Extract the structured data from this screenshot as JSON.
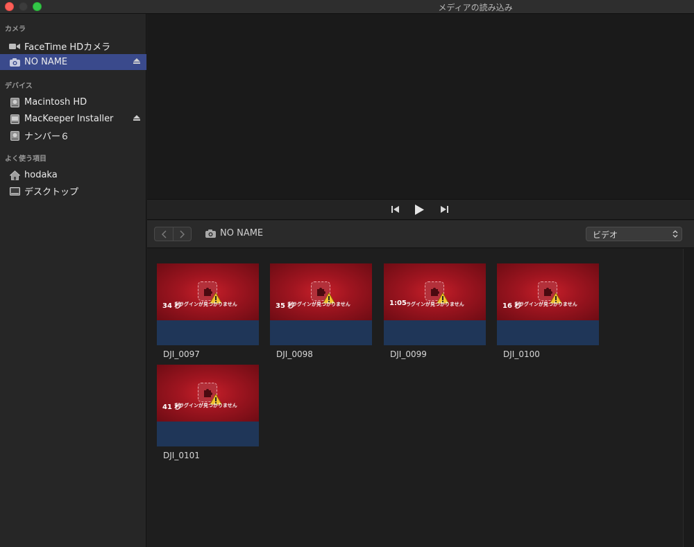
{
  "window": {
    "title": "メディアの読み込み"
  },
  "sidebar": {
    "sections": [
      {
        "label": "カメラ"
      },
      {
        "label": "デバイス"
      },
      {
        "label": "よく使う項目"
      }
    ],
    "items": [
      {
        "label": "FaceTime HDカメラ",
        "icon": "video-camera-icon"
      },
      {
        "label": "NO NAME",
        "icon": "camera-icon",
        "selected": true
      },
      {
        "label": "Macintosh HD",
        "icon": "hard-drive-icon"
      },
      {
        "label": "MacKeeper Installer",
        "icon": "hard-drive-icon"
      },
      {
        "label": "ナンバー６",
        "icon": "hard-drive-icon"
      },
      {
        "label": "hodaka",
        "icon": "home-icon"
      },
      {
        "label": "デスクトップ",
        "icon": "desktop-icon"
      }
    ]
  },
  "browser": {
    "location": "NO NAME",
    "filter": "ビデオ"
  },
  "clips": [
    {
      "name": "DJI_0097",
      "duration": "34 秒",
      "message": "ラグインが見つかりません"
    },
    {
      "name": "DJI_0098",
      "duration": "35 秒",
      "message": "ラグインが見つかりません"
    },
    {
      "name": "DJI_0099",
      "duration": "1:05",
      "message": "ラグインが見つかりません"
    },
    {
      "name": "DJI_0100",
      "duration": "16 秒",
      "message": "ラグインが見つかりません"
    },
    {
      "name": "DJI_0101",
      "duration": "41 秒",
      "message": "ラグインが見つかりません"
    }
  ],
  "colors": {
    "selection": "#3a4a8c",
    "thumb_red": "#b01a24",
    "thumb_blue": "#1f3658"
  }
}
